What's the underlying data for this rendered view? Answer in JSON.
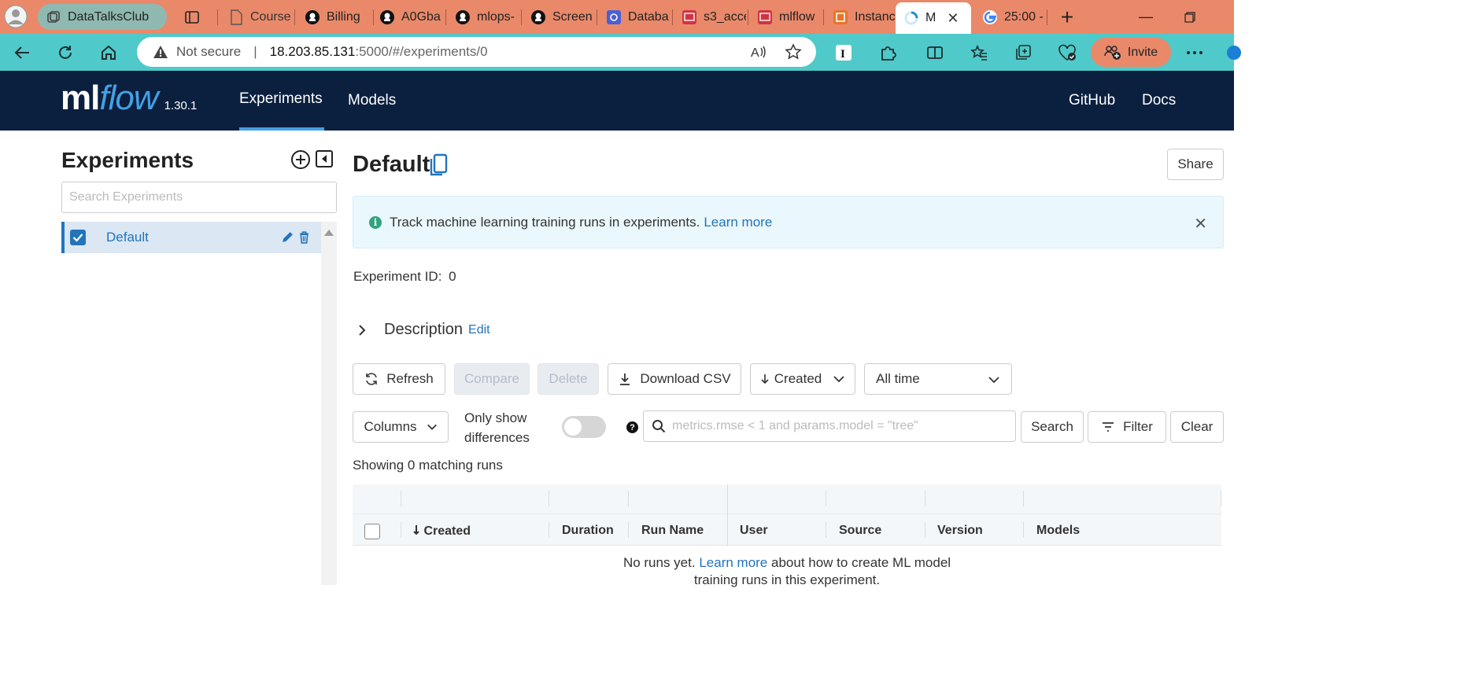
{
  "browser": {
    "tabs": [
      {
        "label": "DataTalksClub",
        "icon": "tab-group-icon"
      },
      {
        "label": "",
        "icon": "tab-actions-icon"
      },
      {
        "label": "Course",
        "icon": "document-icon"
      },
      {
        "label": "Billing",
        "icon": "github-icon"
      },
      {
        "label": "A0Gba",
        "icon": "github-icon"
      },
      {
        "label": "mlops-",
        "icon": "github-icon"
      },
      {
        "label": "Screen",
        "icon": "github-icon"
      },
      {
        "label": "Databa",
        "icon": "aws-icon"
      },
      {
        "label": "s3_acce",
        "icon": "aws-console-icon"
      },
      {
        "label": "mlflow",
        "icon": "aws-console-icon"
      },
      {
        "label": "Instanc",
        "icon": "aws-ec2-icon"
      },
      {
        "label": "M",
        "icon": "loading-icon"
      },
      {
        "label": "25:00 -",
        "icon": "google-icon"
      }
    ],
    "address": {
      "security": "Not secure",
      "host": "18.203.85.131",
      "path": ":5000/#/experiments/0"
    },
    "invite_label": "Invite"
  },
  "header": {
    "logo_ml": "ml",
    "logo_flow": "flow",
    "version": "1.30.1",
    "nav": [
      "Experiments",
      "Models"
    ],
    "right_nav": [
      "GitHub",
      "Docs"
    ]
  },
  "sidebar": {
    "title": "Experiments",
    "search_placeholder": "Search Experiments",
    "experiments": [
      {
        "name": "Default",
        "selected": true
      }
    ]
  },
  "main": {
    "title": "Default",
    "share_label": "Share",
    "alert": {
      "text": "Track machine learning training runs in experiments.",
      "link": "Learn more"
    },
    "experiment_id_label": "Experiment ID:",
    "experiment_id": "0",
    "description_label": "Description",
    "edit_label": "Edit",
    "toolbar": {
      "refresh": "Refresh",
      "compare": "Compare",
      "delete": "Delete",
      "download_csv": "Download CSV",
      "sort": "Created",
      "time_range": "All time",
      "columns": "Columns",
      "only_show_differences": "Only show differences",
      "search_placeholder": "metrics.rmse < 1 and params.model = \"tree\"",
      "search": "Search",
      "filter": "Filter",
      "clear": "Clear"
    },
    "showing": "Showing 0 matching runs",
    "table": {
      "columns": [
        "Created",
        "Duration",
        "Run Name",
        "User",
        "Source",
        "Version",
        "Models"
      ],
      "empty_before": "No runs yet.",
      "empty_link": "Learn more",
      "empty_after": "about how to create ML model training runs in this experiment."
    }
  },
  "colors": {
    "tabstrip": "#e9896a",
    "addressbar": "#4fc9c9",
    "mlflow_header": "#0b1f3f",
    "accent": "#43a0e4",
    "link": "#2374bb"
  }
}
